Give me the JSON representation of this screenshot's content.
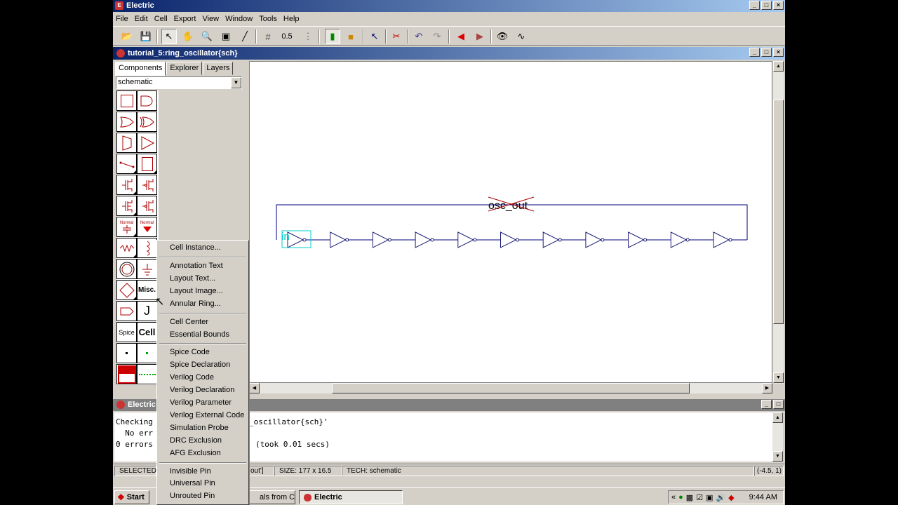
{
  "window": {
    "title": "Electric"
  },
  "menubar": [
    "File",
    "Edit",
    "Cell",
    "Export",
    "View",
    "Window",
    "Tools",
    "Help"
  ],
  "toolbar": {
    "grid_value": "0.5"
  },
  "document": {
    "title": "tutorial_5:ring_oscillator{sch}"
  },
  "leftpanel": {
    "tabs": [
      "Components",
      "Explorer",
      "Layers"
    ],
    "technology_select": "schematic",
    "palette": {
      "misc_label": "Misc.",
      "spice_label": "Spice",
      "cell_label": "Cell",
      "normal1": "Normal",
      "normal2": "Normal"
    }
  },
  "canvas": {
    "export_label": "osc_out",
    "input_label": "in",
    "inverter_count": 11
  },
  "messages": {
    "title": "Electric",
    "lines": [
      "Checking",
      "  No err",
      "0 errors"
    ],
    "suffix_lines": [
      "_oscillator{sch}'",
      "",
      "(took 0.01 secs)"
    ]
  },
  "statusbar": {
    "selected": "SELECTED",
    "export_info": "out']",
    "size": "SIZE: 177 x 16.5",
    "tech": "TECH: schematic",
    "coords": "(-4.5, 1)"
  },
  "context_menu": {
    "groups": [
      [
        "Cell Instance..."
      ],
      [
        "Annotation Text",
        "Layout Text...",
        "Layout Image...",
        "Annular Ring..."
      ],
      [
        "Cell Center",
        "Essential Bounds"
      ],
      [
        "Spice Code",
        "Spice Declaration",
        "Verilog Code",
        "Verilog Declaration",
        "Verilog Parameter",
        "Verilog External Code",
        "Simulation Probe",
        "DRC Exclusion",
        "AFG Exclusion"
      ],
      [
        "Invisible Pin",
        "Universal Pin",
        "Unrouted Pin"
      ]
    ]
  },
  "taskbar": {
    "start": "Start",
    "items": [
      "als from C...",
      "Electric"
    ],
    "clock": "9:44 AM"
  },
  "colors": {
    "titlebar_start": "#0a246a",
    "titlebar_end": "#a6caf0",
    "wire": "#000080",
    "gate": "#1e1e78",
    "highlight": "#00cccc",
    "palette_red": "#aa0000"
  }
}
